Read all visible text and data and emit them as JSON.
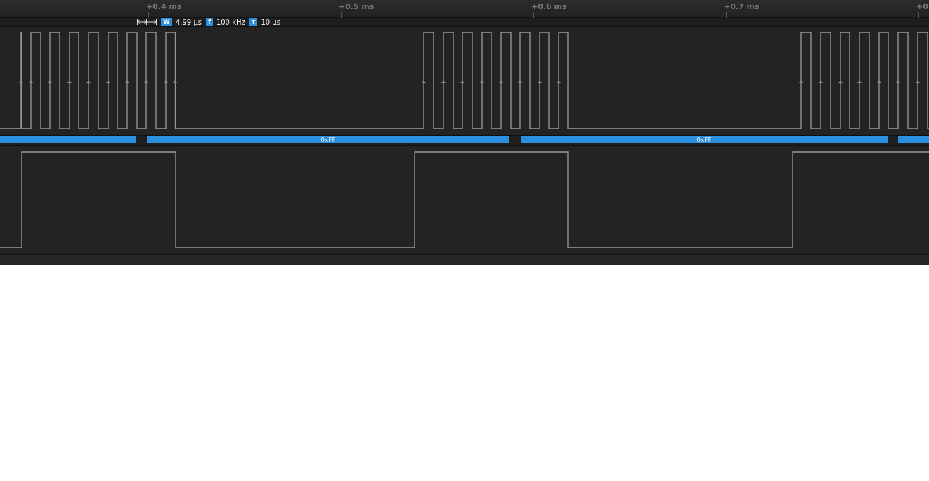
{
  "ruler": {
    "ticks": [
      {
        "label": "+0.4 ms"
      },
      {
        "label": "+0.5 ms"
      },
      {
        "label": "+0.6 ms"
      },
      {
        "label": "+0.7 ms"
      },
      {
        "label": "+0"
      }
    ]
  },
  "measurements": [
    {
      "badge": "W",
      "value": "4.99 µs"
    },
    {
      "badge": "f",
      "value": "100 kHz"
    },
    {
      "badge": "τ",
      "value": "10 µs"
    }
  ],
  "decoded": [
    {
      "kind": "partial"
    },
    {
      "kind": "byte",
      "label": "0xFF"
    },
    {
      "kind": "byte",
      "label": "0xFF"
    },
    {
      "kind": "partial"
    }
  ]
}
